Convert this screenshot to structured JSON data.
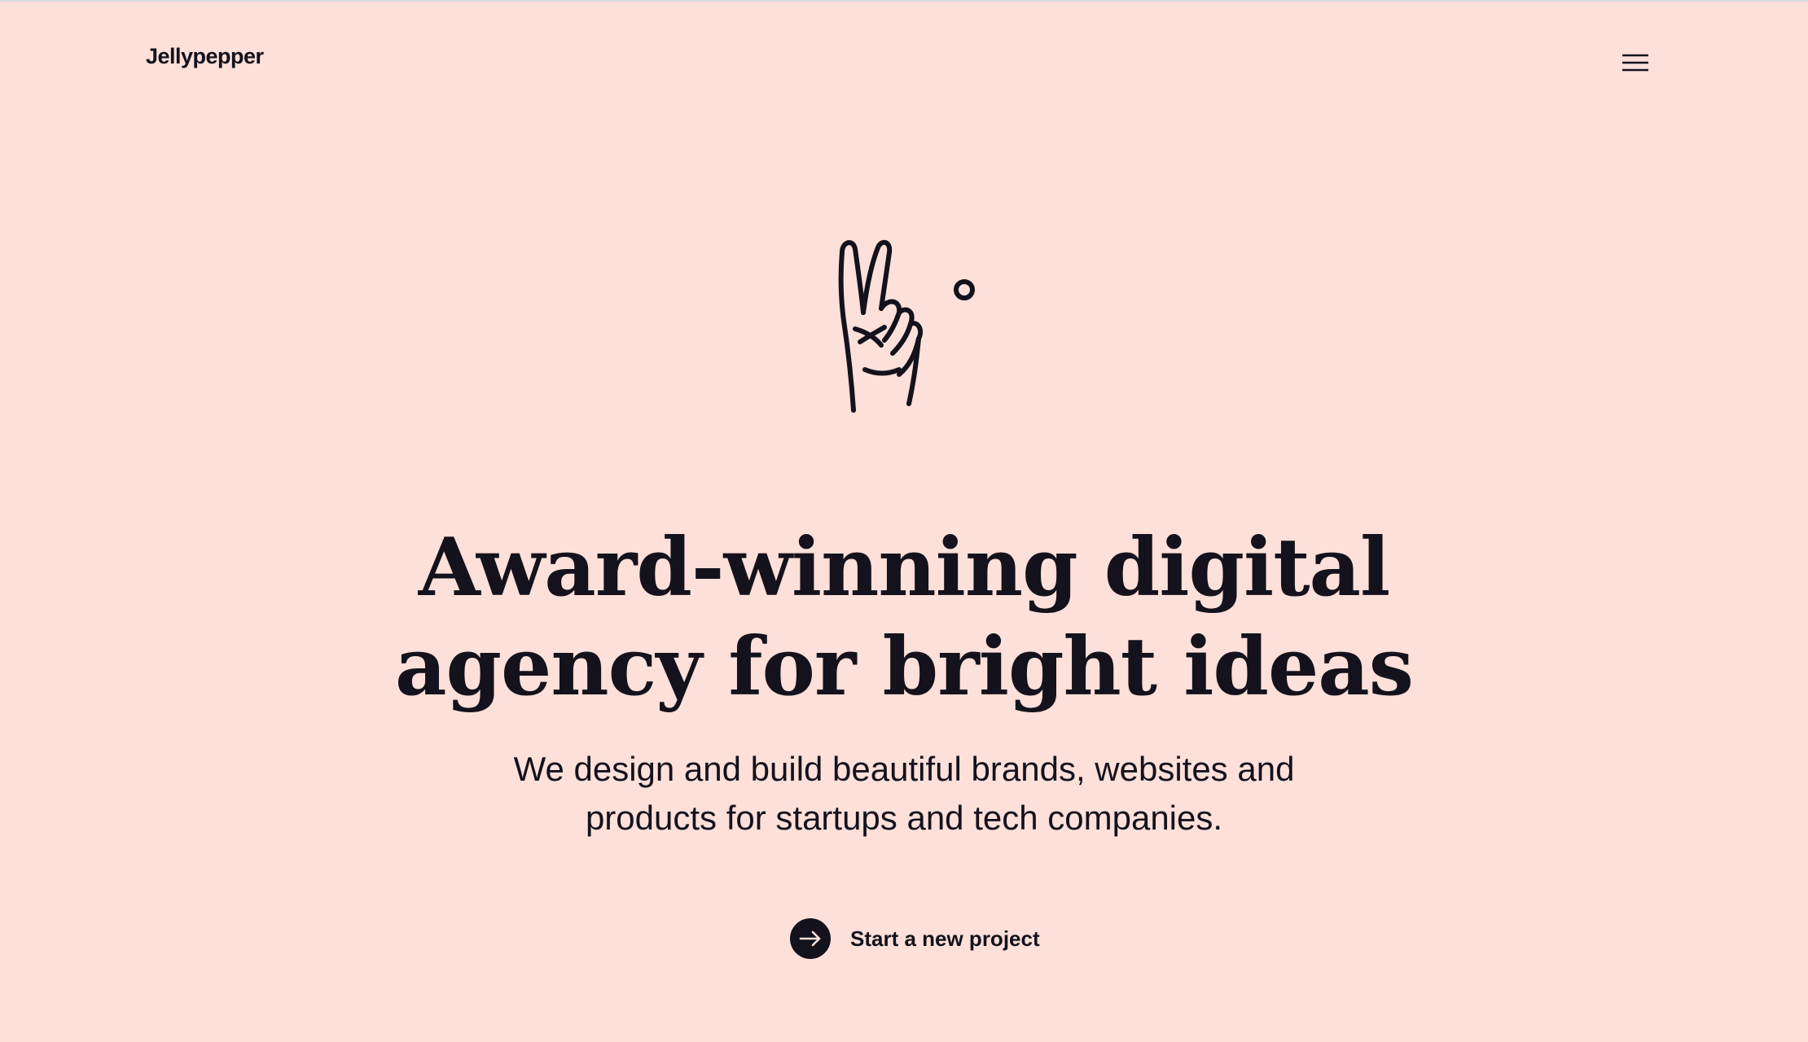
{
  "header": {
    "logo_text": "Jellypepper",
    "menu_icon": "hamburger-menu-icon"
  },
  "hero": {
    "illustration_icon": "peace-hand-icon",
    "headline_line1": "Award-winning digital",
    "headline_line2": "agency for bright ideas",
    "subhead_line1": "We design and build beautiful brands, websites and",
    "subhead_line2": "products for startups and tech companies.",
    "cta_icon": "arrow-right-icon",
    "cta_label": "Start a new project"
  },
  "colors": {
    "background": "#fde0d9",
    "text": "#14121c"
  }
}
